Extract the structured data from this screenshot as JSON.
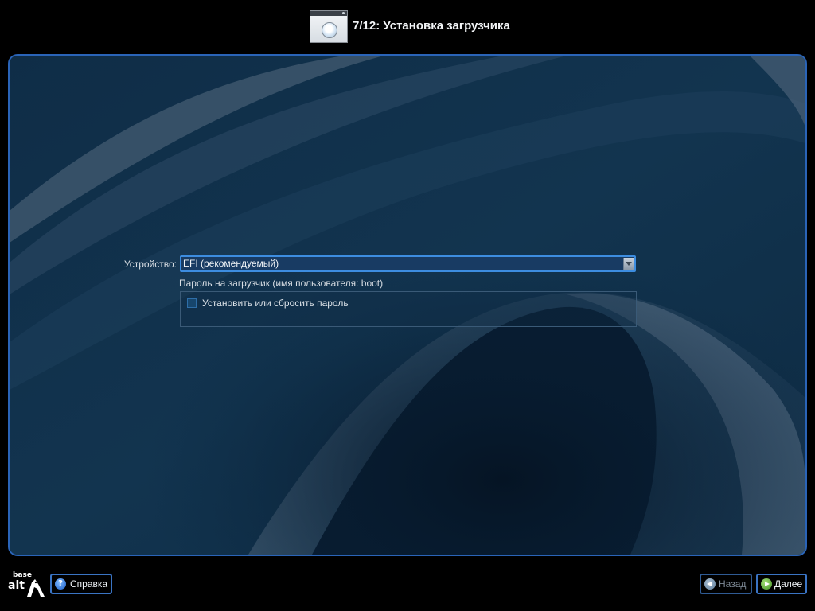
{
  "header": {
    "title": "7/12: Установка загрузчика",
    "icon": "installer-step-icon"
  },
  "form": {
    "device_label": "Устройство:",
    "device_value": "EFI (рекомендуемый)",
    "password_section_title": "Пароль на загрузчик (имя пользователя: boot)",
    "password_checkbox_label": "Установить или сбросить пароль",
    "password_checkbox_checked": false
  },
  "footer": {
    "logo_top": "base",
    "logo_bottom": "alt",
    "help_label": "Справка",
    "back_label": "Назад",
    "next_label": "Далее"
  },
  "colors": {
    "panel_border": "#2a64b8",
    "background": "#0c2a43",
    "select_border": "#3d8de0"
  }
}
